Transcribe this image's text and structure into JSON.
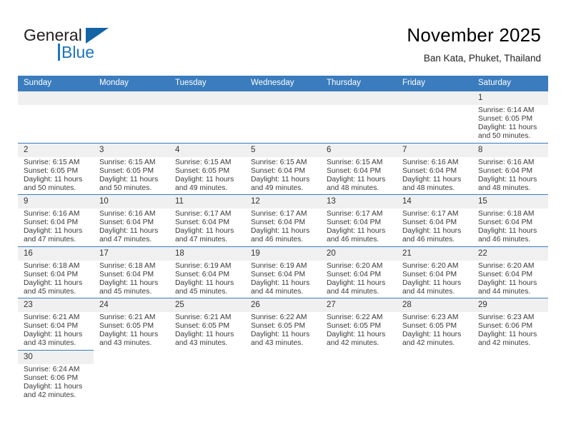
{
  "brand": {
    "name_top": "General",
    "name_bottom": "Blue",
    "triangle_color": "#1464a5",
    "blue_color": "#1c75bc"
  },
  "header": {
    "title": "November 2025",
    "subtitle": "Ban Kata, Phuket, Thailand",
    "accent_color": "#3a7cbe"
  },
  "weekday_headers": [
    "Sunday",
    "Monday",
    "Tuesday",
    "Wednesday",
    "Thursday",
    "Friday",
    "Saturday"
  ],
  "labels": {
    "sunrise_prefix": "Sunrise:",
    "sunset_prefix": "Sunset:",
    "daylight_prefix": "Daylight:"
  },
  "weeks": [
    [
      {
        "empty": true
      },
      {
        "empty": true
      },
      {
        "empty": true
      },
      {
        "empty": true
      },
      {
        "empty": true
      },
      {
        "empty": true
      },
      {
        "day": "1",
        "sunrise": "Sunrise: 6:14 AM",
        "sunset": "Sunset: 6:05 PM",
        "daylight1": "Daylight: 11 hours",
        "daylight2": "and 50 minutes."
      }
    ],
    [
      {
        "day": "2",
        "sunrise": "Sunrise: 6:15 AM",
        "sunset": "Sunset: 6:05 PM",
        "daylight1": "Daylight: 11 hours",
        "daylight2": "and 50 minutes."
      },
      {
        "day": "3",
        "sunrise": "Sunrise: 6:15 AM",
        "sunset": "Sunset: 6:05 PM",
        "daylight1": "Daylight: 11 hours",
        "daylight2": "and 50 minutes."
      },
      {
        "day": "4",
        "sunrise": "Sunrise: 6:15 AM",
        "sunset": "Sunset: 6:05 PM",
        "daylight1": "Daylight: 11 hours",
        "daylight2": "and 49 minutes."
      },
      {
        "day": "5",
        "sunrise": "Sunrise: 6:15 AM",
        "sunset": "Sunset: 6:04 PM",
        "daylight1": "Daylight: 11 hours",
        "daylight2": "and 49 minutes."
      },
      {
        "day": "6",
        "sunrise": "Sunrise: 6:15 AM",
        "sunset": "Sunset: 6:04 PM",
        "daylight1": "Daylight: 11 hours",
        "daylight2": "and 48 minutes."
      },
      {
        "day": "7",
        "sunrise": "Sunrise: 6:16 AM",
        "sunset": "Sunset: 6:04 PM",
        "daylight1": "Daylight: 11 hours",
        "daylight2": "and 48 minutes."
      },
      {
        "day": "8",
        "sunrise": "Sunrise: 6:16 AM",
        "sunset": "Sunset: 6:04 PM",
        "daylight1": "Daylight: 11 hours",
        "daylight2": "and 48 minutes."
      }
    ],
    [
      {
        "day": "9",
        "sunrise": "Sunrise: 6:16 AM",
        "sunset": "Sunset: 6:04 PM",
        "daylight1": "Daylight: 11 hours",
        "daylight2": "and 47 minutes."
      },
      {
        "day": "10",
        "sunrise": "Sunrise: 6:16 AM",
        "sunset": "Sunset: 6:04 PM",
        "daylight1": "Daylight: 11 hours",
        "daylight2": "and 47 minutes."
      },
      {
        "day": "11",
        "sunrise": "Sunrise: 6:17 AM",
        "sunset": "Sunset: 6:04 PM",
        "daylight1": "Daylight: 11 hours",
        "daylight2": "and 47 minutes."
      },
      {
        "day": "12",
        "sunrise": "Sunrise: 6:17 AM",
        "sunset": "Sunset: 6:04 PM",
        "daylight1": "Daylight: 11 hours",
        "daylight2": "and 46 minutes."
      },
      {
        "day": "13",
        "sunrise": "Sunrise: 6:17 AM",
        "sunset": "Sunset: 6:04 PM",
        "daylight1": "Daylight: 11 hours",
        "daylight2": "and 46 minutes."
      },
      {
        "day": "14",
        "sunrise": "Sunrise: 6:17 AM",
        "sunset": "Sunset: 6:04 PM",
        "daylight1": "Daylight: 11 hours",
        "daylight2": "and 46 minutes."
      },
      {
        "day": "15",
        "sunrise": "Sunrise: 6:18 AM",
        "sunset": "Sunset: 6:04 PM",
        "daylight1": "Daylight: 11 hours",
        "daylight2": "and 46 minutes."
      }
    ],
    [
      {
        "day": "16",
        "sunrise": "Sunrise: 6:18 AM",
        "sunset": "Sunset: 6:04 PM",
        "daylight1": "Daylight: 11 hours",
        "daylight2": "and 45 minutes."
      },
      {
        "day": "17",
        "sunrise": "Sunrise: 6:18 AM",
        "sunset": "Sunset: 6:04 PM",
        "daylight1": "Daylight: 11 hours",
        "daylight2": "and 45 minutes."
      },
      {
        "day": "18",
        "sunrise": "Sunrise: 6:19 AM",
        "sunset": "Sunset: 6:04 PM",
        "daylight1": "Daylight: 11 hours",
        "daylight2": "and 45 minutes."
      },
      {
        "day": "19",
        "sunrise": "Sunrise: 6:19 AM",
        "sunset": "Sunset: 6:04 PM",
        "daylight1": "Daylight: 11 hours",
        "daylight2": "and 44 minutes."
      },
      {
        "day": "20",
        "sunrise": "Sunrise: 6:20 AM",
        "sunset": "Sunset: 6:04 PM",
        "daylight1": "Daylight: 11 hours",
        "daylight2": "and 44 minutes."
      },
      {
        "day": "21",
        "sunrise": "Sunrise: 6:20 AM",
        "sunset": "Sunset: 6:04 PM",
        "daylight1": "Daylight: 11 hours",
        "daylight2": "and 44 minutes."
      },
      {
        "day": "22",
        "sunrise": "Sunrise: 6:20 AM",
        "sunset": "Sunset: 6:04 PM",
        "daylight1": "Daylight: 11 hours",
        "daylight2": "and 44 minutes."
      }
    ],
    [
      {
        "day": "23",
        "sunrise": "Sunrise: 6:21 AM",
        "sunset": "Sunset: 6:04 PM",
        "daylight1": "Daylight: 11 hours",
        "daylight2": "and 43 minutes."
      },
      {
        "day": "24",
        "sunrise": "Sunrise: 6:21 AM",
        "sunset": "Sunset: 6:05 PM",
        "daylight1": "Daylight: 11 hours",
        "daylight2": "and 43 minutes."
      },
      {
        "day": "25",
        "sunrise": "Sunrise: 6:21 AM",
        "sunset": "Sunset: 6:05 PM",
        "daylight1": "Daylight: 11 hours",
        "daylight2": "and 43 minutes."
      },
      {
        "day": "26",
        "sunrise": "Sunrise: 6:22 AM",
        "sunset": "Sunset: 6:05 PM",
        "daylight1": "Daylight: 11 hours",
        "daylight2": "and 43 minutes."
      },
      {
        "day": "27",
        "sunrise": "Sunrise: 6:22 AM",
        "sunset": "Sunset: 6:05 PM",
        "daylight1": "Daylight: 11 hours",
        "daylight2": "and 42 minutes."
      },
      {
        "day": "28",
        "sunrise": "Sunrise: 6:23 AM",
        "sunset": "Sunset: 6:05 PM",
        "daylight1": "Daylight: 11 hours",
        "daylight2": "and 42 minutes."
      },
      {
        "day": "29",
        "sunrise": "Sunrise: 6:23 AM",
        "sunset": "Sunset: 6:06 PM",
        "daylight1": "Daylight: 11 hours",
        "daylight2": "and 42 minutes."
      }
    ],
    [
      {
        "day": "30",
        "sunrise": "Sunrise: 6:24 AM",
        "sunset": "Sunset: 6:06 PM",
        "daylight1": "Daylight: 11 hours",
        "daylight2": "and 42 minutes."
      },
      {
        "void": true
      },
      {
        "void": true
      },
      {
        "void": true
      },
      {
        "void": true
      },
      {
        "void": true
      },
      {
        "void": true
      }
    ]
  ]
}
